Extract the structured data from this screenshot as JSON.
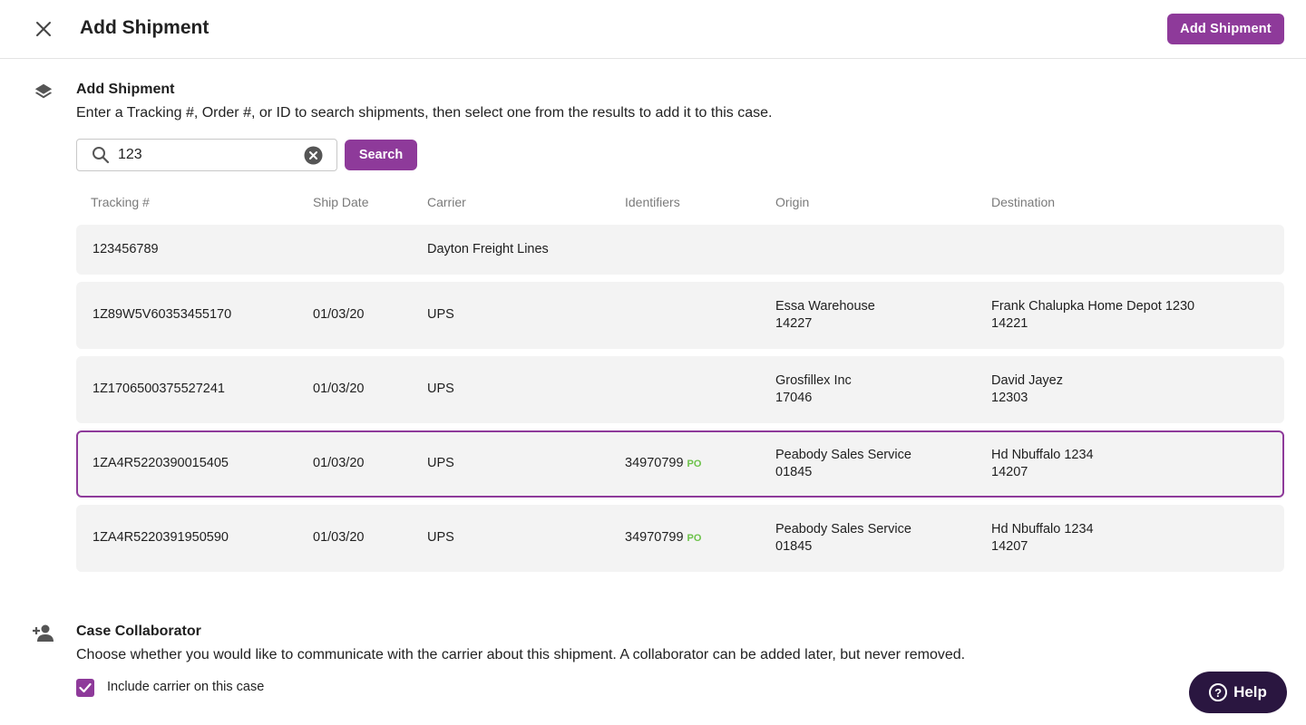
{
  "header": {
    "title": "Add Shipment",
    "add_button_label": "Add Shipment"
  },
  "shipment_section": {
    "title": "Add Shipment",
    "description": "Enter a Tracking #, Order #, or ID to search shipments, then select one from the results to add it to this case.",
    "search": {
      "value": "123",
      "button_label": "Search"
    },
    "columns": [
      "Tracking #",
      "Ship Date",
      "Carrier",
      "Identifiers",
      "Origin",
      "Destination"
    ],
    "rows": [
      {
        "tracking": "123456789",
        "ship_date": "",
        "carrier": "Dayton Freight Lines",
        "identifier": "",
        "identifier_type": "",
        "origin_name": "",
        "origin_zip": "",
        "dest_name": "",
        "dest_zip": "",
        "selected": false
      },
      {
        "tracking": "1Z89W5V60353455170",
        "ship_date": "01/03/20",
        "carrier": "UPS",
        "identifier": "",
        "identifier_type": "",
        "origin_name": "Essa Warehouse",
        "origin_zip": "14227",
        "dest_name": "Frank Chalupka Home Depot 1230",
        "dest_zip": "14221",
        "selected": false
      },
      {
        "tracking": "1Z1706500375527241",
        "ship_date": "01/03/20",
        "carrier": "UPS",
        "identifier": "",
        "identifier_type": "",
        "origin_name": "Grosfillex Inc",
        "origin_zip": "17046",
        "dest_name": "David Jayez",
        "dest_zip": "12303",
        "selected": false
      },
      {
        "tracking": "1ZA4R5220390015405",
        "ship_date": "01/03/20",
        "carrier": "UPS",
        "identifier": "34970799",
        "identifier_type": "PO",
        "origin_name": "Peabody Sales Service",
        "origin_zip": "01845",
        "dest_name": "Hd Nbuffalo 1234",
        "dest_zip": "14207",
        "selected": true
      },
      {
        "tracking": "1ZA4R5220391950590",
        "ship_date": "01/03/20",
        "carrier": "UPS",
        "identifier": "34970799",
        "identifier_type": "PO",
        "origin_name": "Peabody Sales Service",
        "origin_zip": "01845",
        "dest_name": "Hd Nbuffalo 1234",
        "dest_zip": "14207",
        "selected": false
      }
    ]
  },
  "collaborator_section": {
    "title": "Case Collaborator",
    "description": "Choose whether you would like to communicate with the carrier about this shipment. A collaborator can be added later, but never removed.",
    "checkbox_label": "Include carrier on this case",
    "checked": true
  },
  "help": {
    "label": "Help"
  },
  "colors": {
    "accent": "#8e3a9a",
    "po_badge": "#6cc24a",
    "help_bg": "#2a1640",
    "row_bg": "#f3f3f3"
  }
}
